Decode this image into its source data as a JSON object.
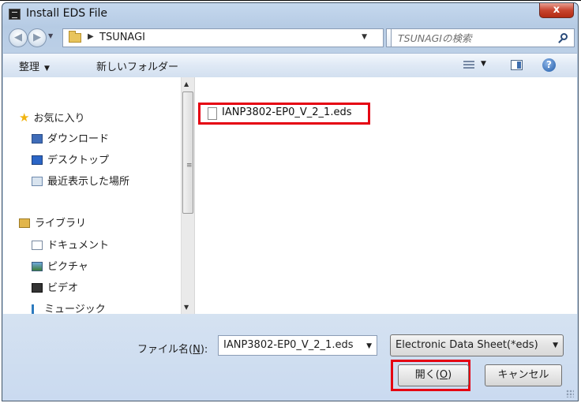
{
  "window": {
    "title": "Install EDS File",
    "close_glyph": "x"
  },
  "nav": {
    "back_icon": "back-arrow-icon",
    "forward_icon": "forward-arrow-icon",
    "breadcrumb": [
      "TSUNAGI"
    ],
    "search_placeholder": "TSUNAGIの検索"
  },
  "toolbar": {
    "organize_label": "整理",
    "new_folder_label": "新しいフォルダー"
  },
  "sidebar": {
    "favorites_label": "お気に入り",
    "favorites": [
      "ダウンロード",
      "デスクトップ",
      "最近表示した場所"
    ],
    "libraries_label": "ライブラリ",
    "libraries": [
      "ドキュメント",
      "ピクチャ",
      "ビデオ",
      "ミュージック"
    ]
  },
  "files": [
    {
      "name": "IANP3802-EP0_V_2_1.eds",
      "highlighted": true
    }
  ],
  "footer": {
    "filename_label": "ファイル名(",
    "filename_hotkey": "N",
    "filename_label_end": "):",
    "filename_value": "IANP3802-EP0_V_2_1.eds",
    "filetype_value": "Electronic Data Sheet(*eds)",
    "open_label_pre": "開く(",
    "open_hotkey": "O",
    "open_label_post": ")",
    "cancel_label": "キャンセル"
  },
  "colors": {
    "highlight": "#e50012",
    "frame": "#b9cde6"
  }
}
